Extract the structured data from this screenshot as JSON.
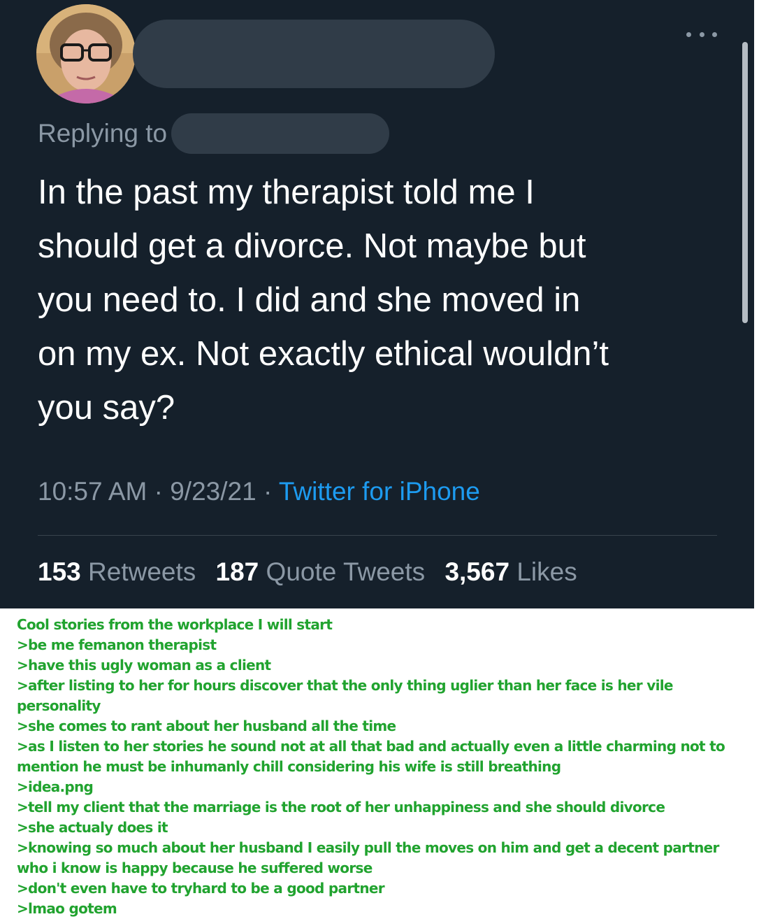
{
  "tweet": {
    "replying_to_label": "Replying to",
    "text": "In the past my therapist told me I\nshould get a divorce. Not maybe but\nyou need to. I did and she moved in\non my ex. Not exactly ethical wouldn’t\nyou say?",
    "time": "10:57 AM",
    "separator": " · ",
    "date": "9/23/21",
    "source": "Twitter for iPhone",
    "retweets_count": "153",
    "retweets_label": "Retweets",
    "quote_tweets_count": "187",
    "quote_tweets_label": "Quote Tweets",
    "likes_count": "3,567",
    "likes_label": "Likes"
  },
  "greentext": {
    "lines": [
      "Cool stories from the workplace I will start",
      ">be me femanon therapist",
      ">have this ugly woman as a client",
      ">after listing to her for hours discover that the only thing uglier than her face is her vile personality",
      ">she comes to rant about her husband all the time",
      ">as I listen to her stories he sound not at all that bad and actually even a little charming not to mention he must be inhumanly chill considering his wife is still breathing",
      ">idea.png",
      ">tell my client that the marriage is the root of her unhappiness and she should divorce",
      ">she actualy does it",
      ">knowing so much about her husband I easily pull the moves on him and get a decent partner who i know is happy because he suffered worse",
      ">don't even have to tryhard to be a good partner",
      ">lmao gotem"
    ]
  },
  "colors": {
    "background": "#15202b",
    "muted_text": "#8b98a5",
    "link": "#1d9bf0",
    "greentext": "#21a32f",
    "redaction": "#303c48"
  },
  "icons": {
    "more": "more-horizontal-icon"
  }
}
